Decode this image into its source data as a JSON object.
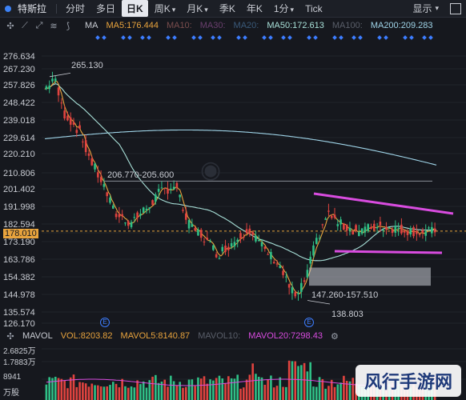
{
  "topbar": {
    "stock": "特斯拉",
    "tabs": [
      {
        "label": "分时"
      },
      {
        "label": "多日"
      },
      {
        "label": "日K",
        "active": true
      },
      {
        "label": "周K",
        "dd": true
      },
      {
        "label": "月K",
        "dd": true
      },
      {
        "label": "季K"
      },
      {
        "label": "年K"
      },
      {
        "label": "1分",
        "dd": true
      },
      {
        "label": "Tick"
      }
    ],
    "display": "显示"
  },
  "toolbar": {
    "ma_label": "MA",
    "indicators": [
      {
        "label": "MA5:176.444",
        "color": "#e8a33d"
      },
      {
        "label": "MA10:",
        "color": "#7a4d4d"
      },
      {
        "label": "MA30:",
        "color": "#6a3f6e"
      },
      {
        "label": "MA20:",
        "color": "#3a5a7a"
      },
      {
        "label": "MA50:172.613",
        "color": "#a8e0d8"
      },
      {
        "label": "MA100:",
        "color": "#5a5f6a"
      },
      {
        "label": "MA200:209.283",
        "color": "#9fd4e8"
      }
    ]
  },
  "price_axis": [
    "276.634",
    "267.230",
    "257.826",
    "248.422",
    "239.018",
    "229.614",
    "220.210",
    "210.806",
    "201.402",
    "191.998",
    "182.594",
    "178.010",
    "173.190",
    "163.786",
    "154.382",
    "144.978",
    "135.574",
    "126.170"
  ],
  "annotations": {
    "high": "265.130",
    "range_top": "206.770-205.600",
    "range_bottom": "147.260-157.510",
    "low": "138.803",
    "event": "E"
  },
  "volume": {
    "label": "MAVOL",
    "vol": "VOL:8203.82",
    "mavol5": "MAVOL5:8140.87",
    "mavol10": "MAVOL10:",
    "mavol20": "MAVOL20:7298.43",
    "axis": [
      "2.6825万",
      "1.7883万",
      "8941",
      "万股"
    ]
  },
  "watermark": "风行手游网",
  "colors": {
    "up": "#2fbf86",
    "down": "#e0433f",
    "ma5": "#e8a33d",
    "ma50": "#a8e0d8",
    "ma200": "#9fd4e8",
    "accent": "#d94ce0",
    "grid": "#2a2e37"
  }
}
